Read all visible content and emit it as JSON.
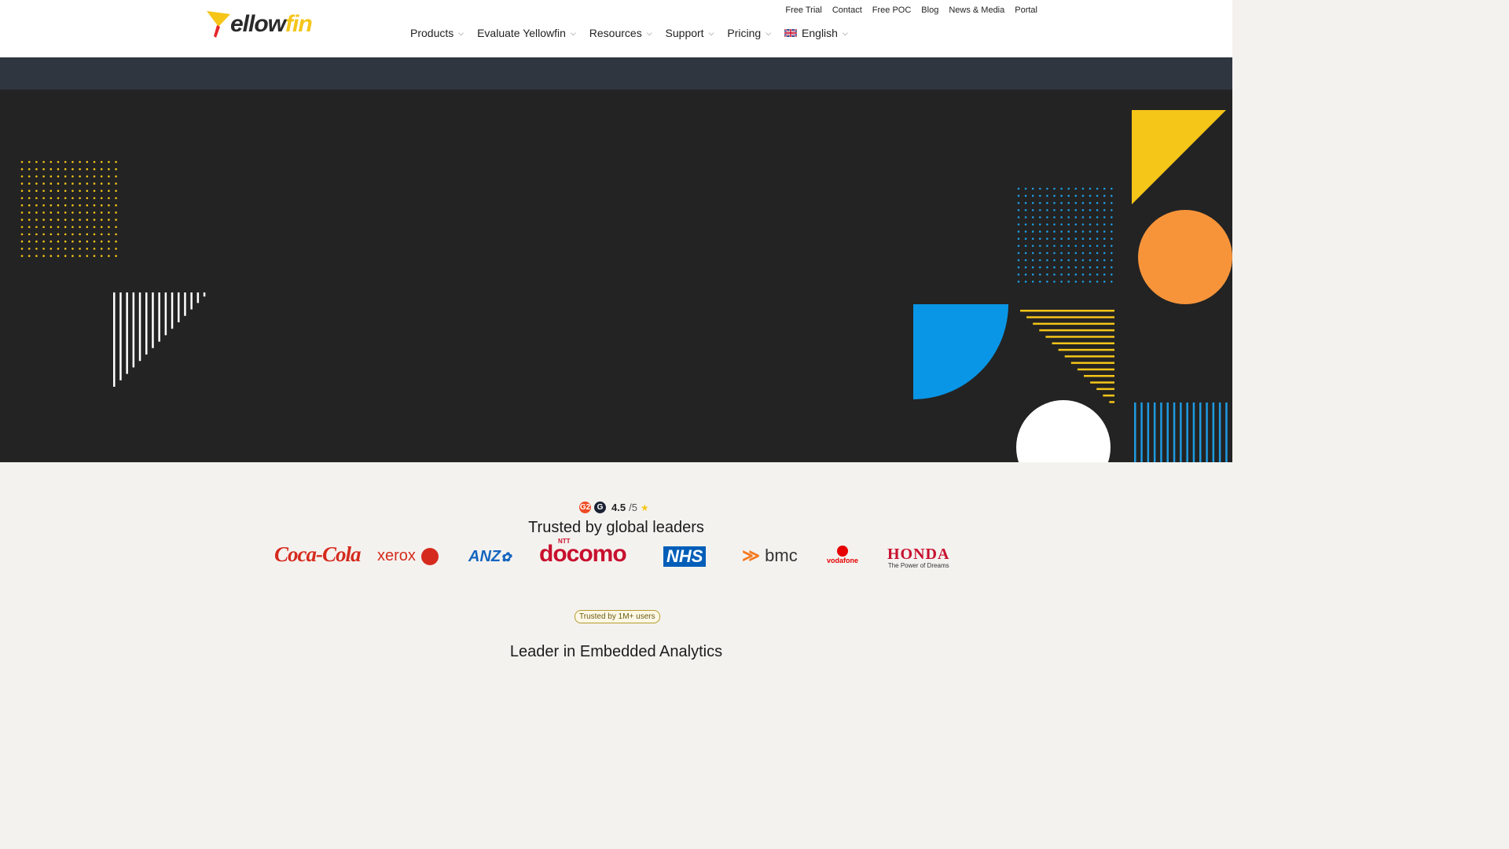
{
  "brand": {
    "logo_main": "ellow",
    "logo_accent": "fin"
  },
  "utility_nav": [
    "Free Trial",
    "Contact",
    "Free POC",
    "Blog",
    "News & Media",
    "Portal"
  ],
  "main_nav": {
    "products": "Products",
    "evaluate": "Evaluate Yellowfin",
    "resources": "Resources",
    "support": "Support",
    "pricing": "Pricing",
    "language": "English"
  },
  "rating": {
    "score": "4.5",
    "out_of": "/5",
    "g2_icon": "G2",
    "google_icon": "G"
  },
  "trust": {
    "title": "Trusted by global leaders",
    "logos": {
      "cocacola": "Coca-Cola",
      "xerox": "xerox",
      "anz": "ANZ",
      "docomo_small": "NTT",
      "docomo": "docomo",
      "nhs": "NHS",
      "bmc": "bmc",
      "vodafone": "vodafone",
      "honda": "HONDA",
      "honda_tag": "The Power of Dreams"
    }
  },
  "pill": "Trusted by 1M+ users",
  "leader_title": "Leader in Embedded Analytics",
  "colors": {
    "yellow": "#f5c518",
    "orange": "#f7943a",
    "blue": "#0a96e6",
    "hero_bg": "#232323",
    "subbar": "#2f3640"
  }
}
